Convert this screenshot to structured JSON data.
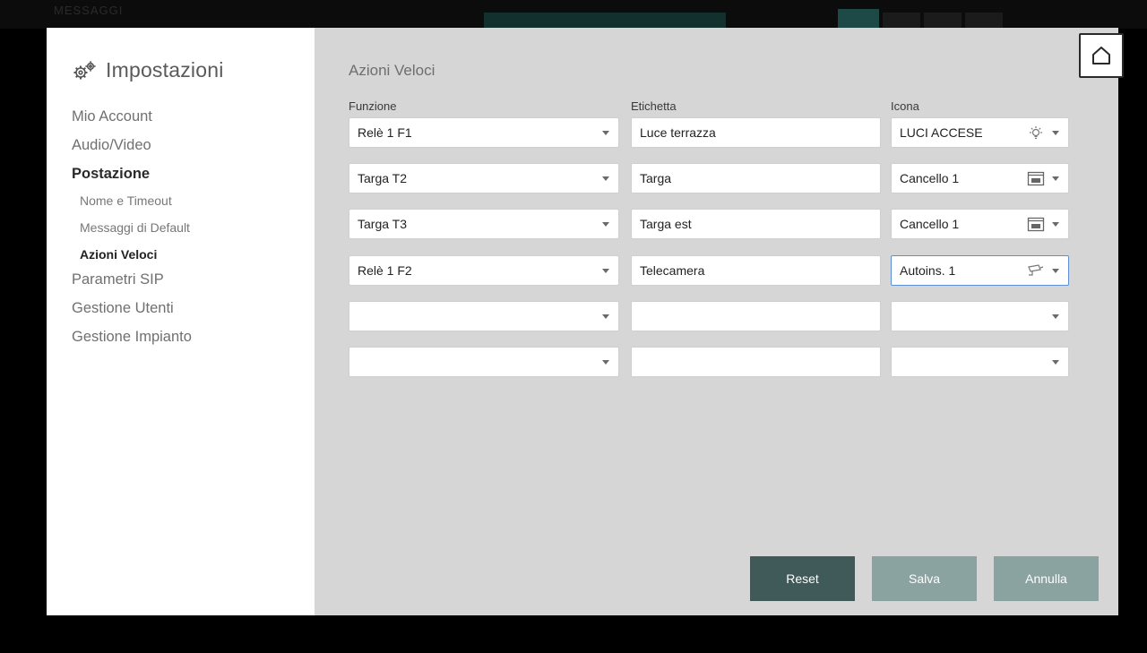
{
  "background": {
    "ghost_text": "MESSAGGI"
  },
  "sidebar": {
    "title": "Impostazioni",
    "items": [
      {
        "label": "Mio Account",
        "level": 0,
        "active": false
      },
      {
        "label": "Audio/Video",
        "level": 0,
        "active": false
      },
      {
        "label": "Postazione",
        "level": 0,
        "active": true
      },
      {
        "label": "Nome e Timeout",
        "level": 1,
        "active": false
      },
      {
        "label": "Messaggi di Default",
        "level": 1,
        "active": false
      },
      {
        "label": "Azioni Veloci",
        "level": 1,
        "active": true
      },
      {
        "label": "Parametri SIP",
        "level": 0,
        "active": false
      },
      {
        "label": "Gestione Utenti",
        "level": 0,
        "active": false
      },
      {
        "label": "Gestione Impianto",
        "level": 0,
        "active": false
      }
    ]
  },
  "main": {
    "title": "Azioni Veloci",
    "columns": {
      "function": "Funzione",
      "label": "Etichetta",
      "icon": "Icona"
    },
    "rows": [
      {
        "function": "Relè 1 F1",
        "label": "Luce terrazza",
        "icon_label": "LUCI ACCESE",
        "icon": "lightbulb-icon",
        "focused": false
      },
      {
        "function": "Targa T2",
        "label": "Targa",
        "icon_label": "Cancello 1",
        "icon": "gate-icon",
        "focused": false
      },
      {
        "function": "Targa T3",
        "label": "Targa est",
        "icon_label": "Cancello 1",
        "icon": "gate-icon",
        "focused": false
      },
      {
        "function": "Relè 1 F2",
        "label": "Telecamera",
        "icon_label": "Autoins. 1",
        "icon": "camera-icon",
        "focused": true
      },
      {
        "function": "",
        "label": "",
        "icon_label": "",
        "icon": "",
        "focused": false
      },
      {
        "function": "",
        "label": "",
        "icon_label": "",
        "icon": "",
        "focused": false
      }
    ]
  },
  "buttons": {
    "reset": "Reset",
    "save": "Salva",
    "cancel": "Annulla"
  },
  "colors": {
    "accent_dark": "#3f5a58",
    "accent_light": "#8aa3a1",
    "focus_border": "#5d8fd6",
    "modal_bg": "#d6d6d6"
  }
}
